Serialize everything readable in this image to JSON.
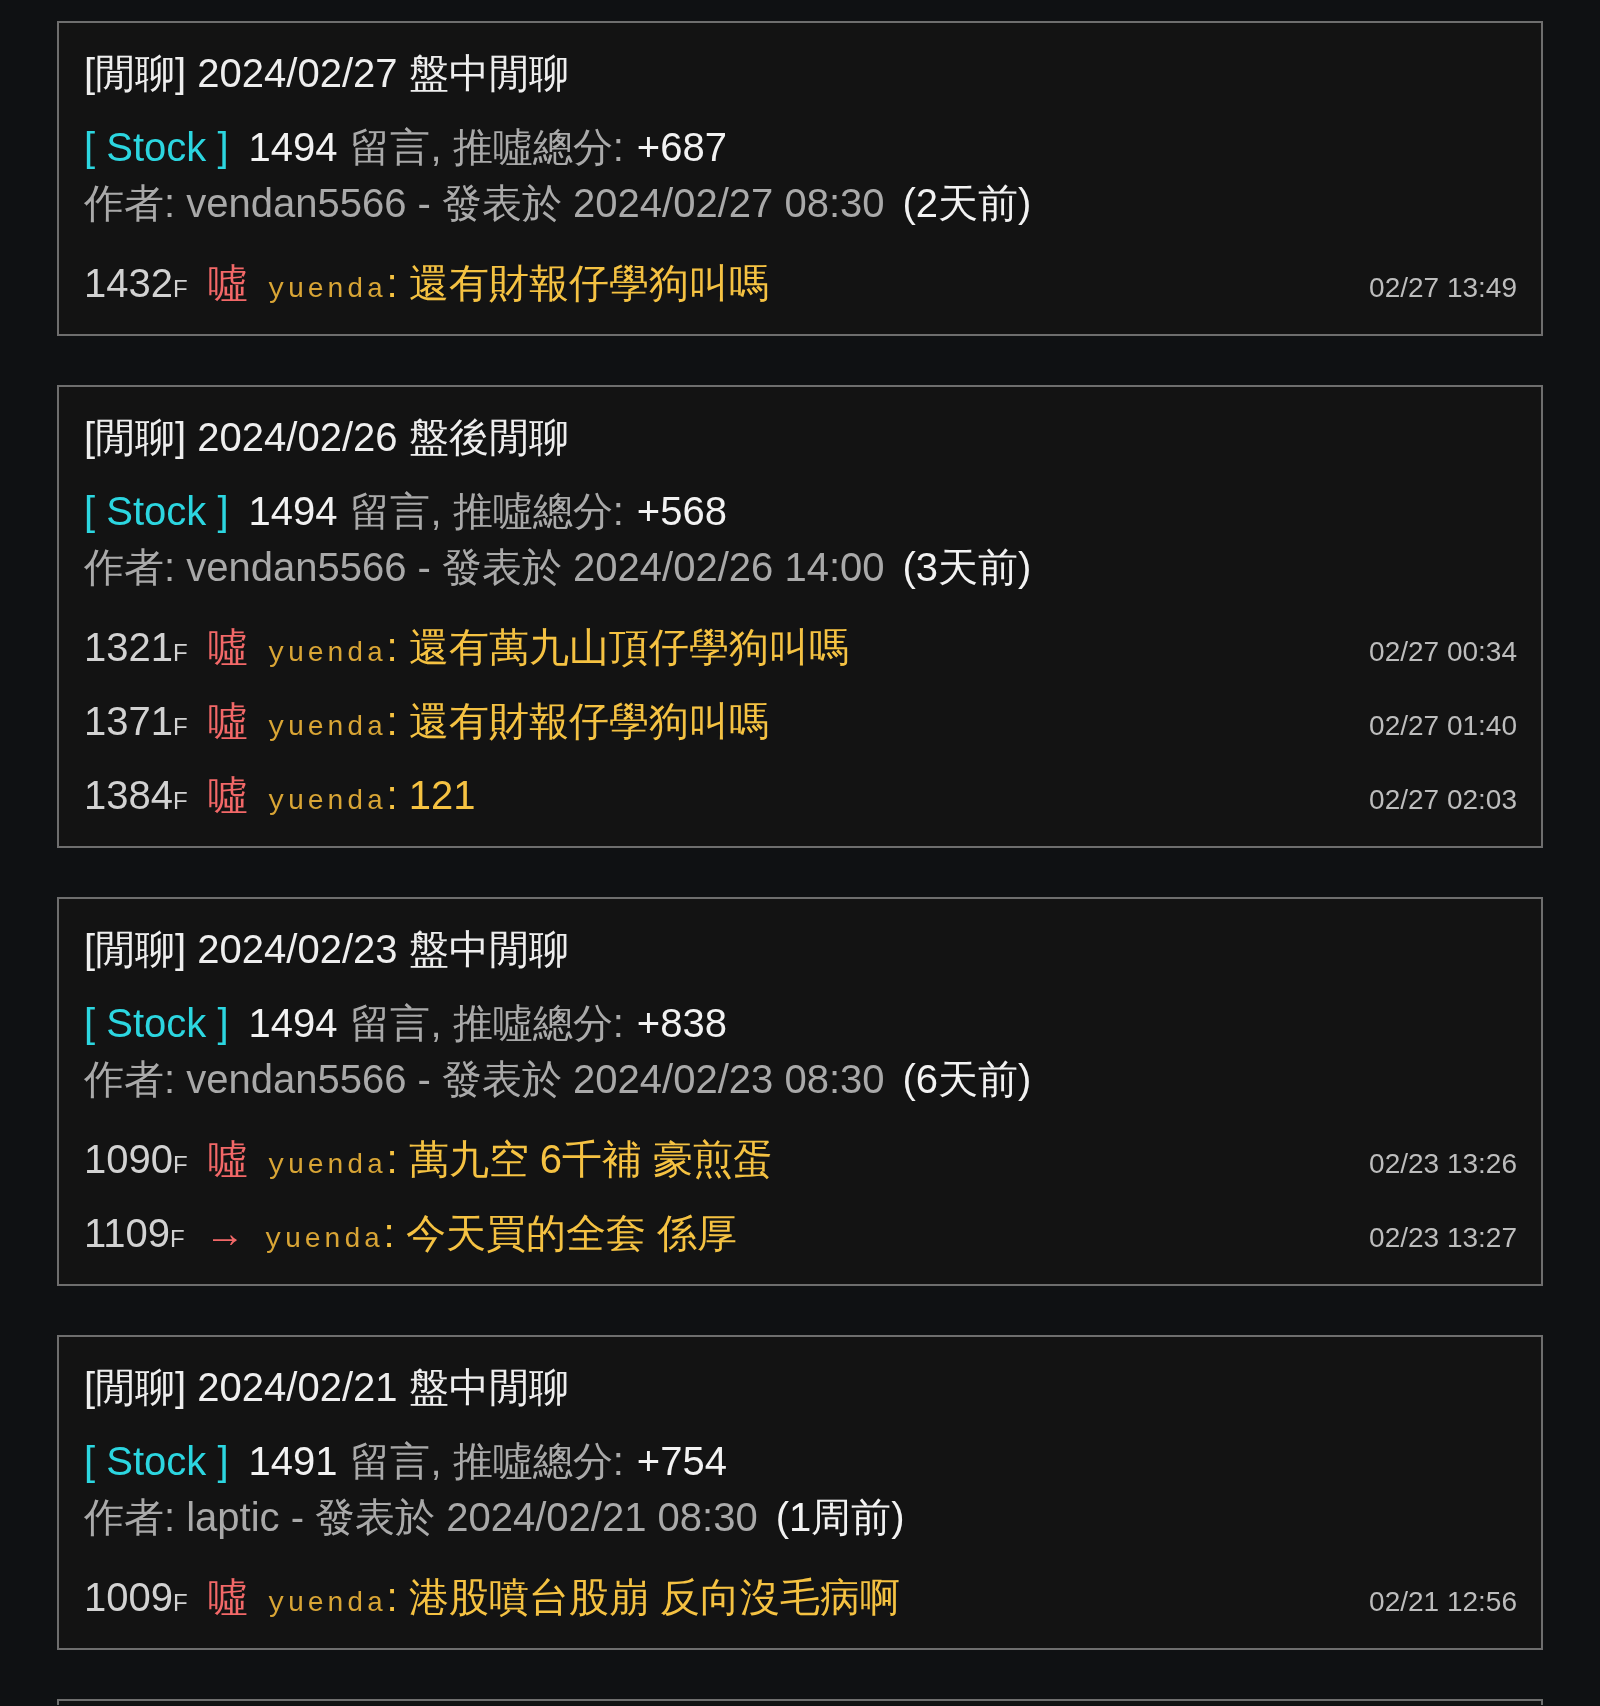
{
  "posts": [
    {
      "title": "[閒聊] 2024/02/27 盤中閒聊",
      "board": "[ Stock ]",
      "comment_count": "1494",
      "stats_label": "留言, 推噓總分:",
      "score": "+687",
      "byline": "作者: vendan5566 - 發表於 2024/02/27 08:30",
      "age": "(2天前)",
      "comments": [
        {
          "floor": "1432",
          "floor_unit": "F",
          "tag": "噓",
          "user": "yuenda",
          "content": ": 還有財報仔學狗叫嗎",
          "time": "02/27 13:49"
        }
      ]
    },
    {
      "title": "[閒聊] 2024/02/26 盤後閒聊",
      "board": "[ Stock ]",
      "comment_count": "1494",
      "stats_label": "留言, 推噓總分:",
      "score": "+568",
      "byline": "作者: vendan5566 - 發表於 2024/02/26 14:00",
      "age": "(3天前)",
      "comments": [
        {
          "floor": "1321",
          "floor_unit": "F",
          "tag": "噓",
          "user": "yuenda",
          "content": ": 還有萬九山頂仔學狗叫嗎",
          "time": "02/27 00:34"
        },
        {
          "floor": "1371",
          "floor_unit": "F",
          "tag": "噓",
          "user": "yuenda",
          "content": ": 還有財報仔學狗叫嗎",
          "time": "02/27 01:40"
        },
        {
          "floor": "1384",
          "floor_unit": "F",
          "tag": "噓",
          "user": "yuenda",
          "content": ": 121",
          "time": "02/27 02:03"
        }
      ]
    },
    {
      "title": "[閒聊] 2024/02/23 盤中閒聊",
      "board": "[ Stock ]",
      "comment_count": "1494",
      "stats_label": "留言, 推噓總分:",
      "score": "+838",
      "byline": "作者: vendan5566 - 發表於 2024/02/23 08:30",
      "age": "(6天前)",
      "comments": [
        {
          "floor": "1090",
          "floor_unit": "F",
          "tag": "噓",
          "user": "yuenda",
          "content": ": 萬九空 6千補 豪煎蛋",
          "time": "02/23 13:26"
        },
        {
          "floor": "1109",
          "floor_unit": "F",
          "tag": "→",
          "user": "yuenda",
          "content": ": 今天買的全套 係厚",
          "time": "02/23 13:27"
        }
      ]
    },
    {
      "title": "[閒聊] 2024/02/21 盤中閒聊",
      "board": "[ Stock ]",
      "comment_count": "1491",
      "stats_label": "留言, 推噓總分:",
      "score": "+754",
      "byline": "作者: laptic - 發表於 2024/02/21 08:30",
      "age": "(1周前)",
      "comments": [
        {
          "floor": "1009",
          "floor_unit": "F",
          "tag": "噓",
          "user": "yuenda",
          "content": ": 港股噴台股崩 反向沒毛病啊",
          "time": "02/21 12:56"
        }
      ]
    }
  ]
}
